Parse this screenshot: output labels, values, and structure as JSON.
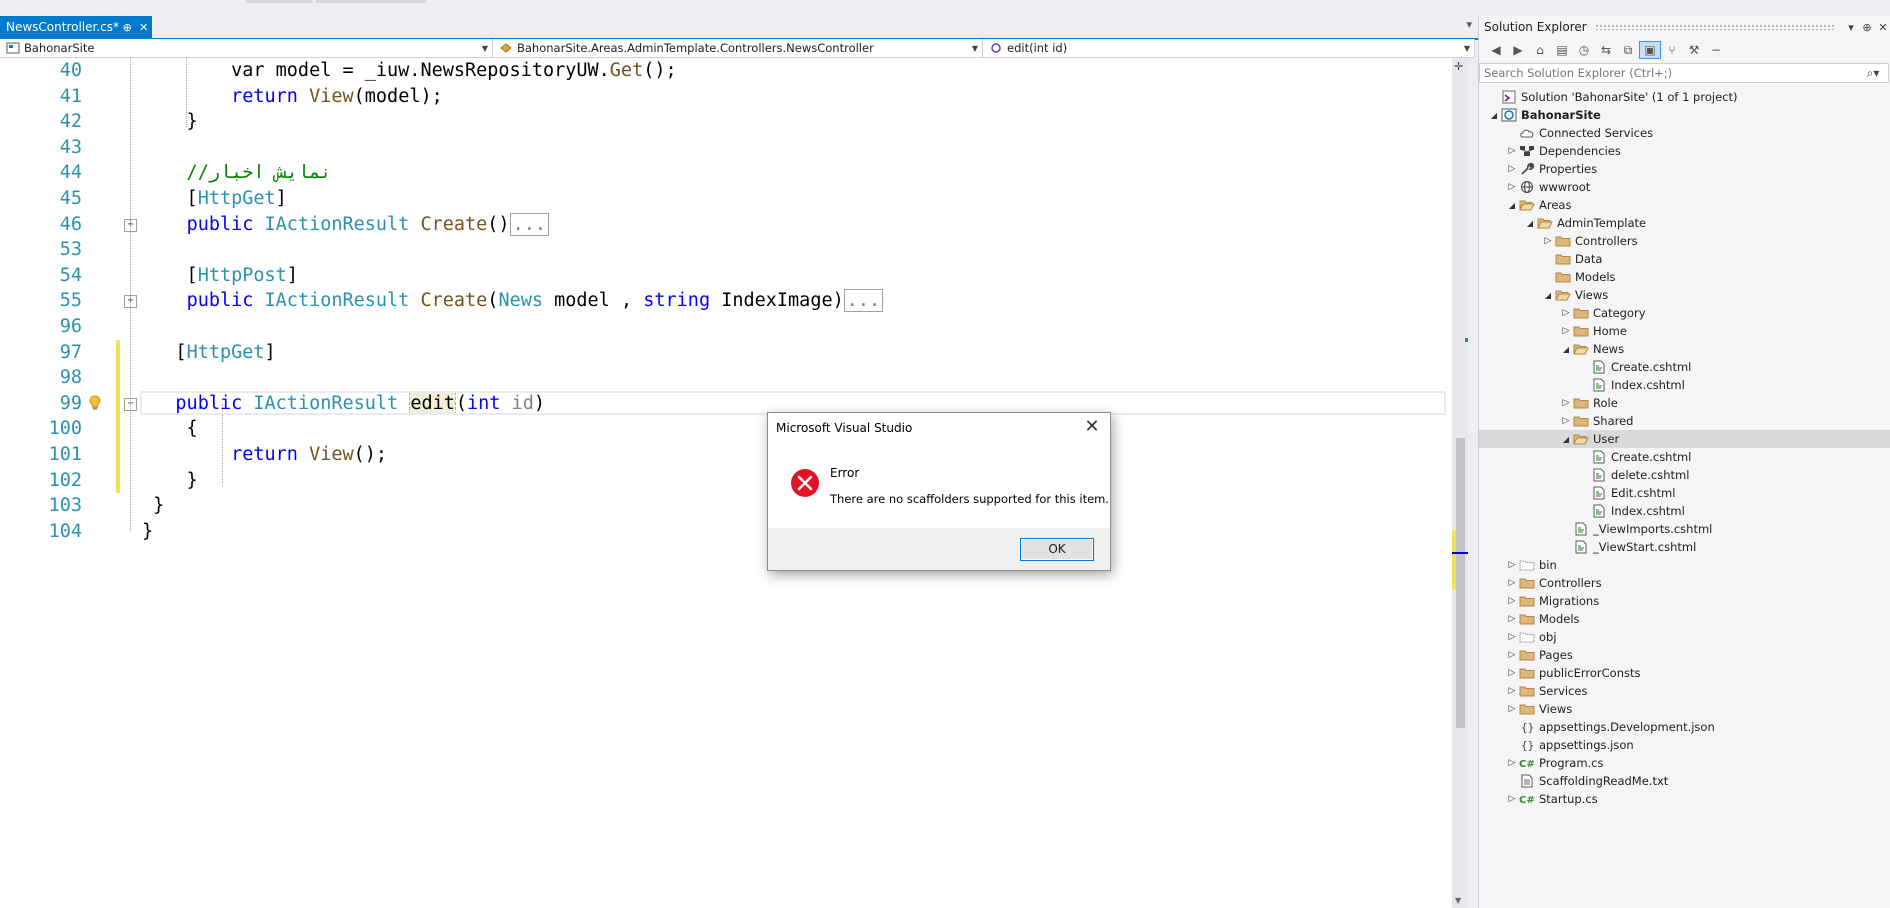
{
  "editor_tab": {
    "name": "NewsController.cs*",
    "pin_icon": "pin-icon",
    "close_icon": "close-icon"
  },
  "navbar": {
    "project": "BahonarSite",
    "class": "BahonarSite.Areas.AdminTemplate.Controllers.NewsController",
    "member": "edit(int id)"
  },
  "code_lines": [
    {
      "num": "40",
      "parts": [
        [
          "",
          "        var model = _iuw.NewsRepositoryUW."
        ],
        [
          "mt",
          "Get"
        ],
        [
          "",
          "();"
        ]
      ]
    },
    {
      "num": "41",
      "parts": [
        [
          "",
          "        "
        ],
        [
          "kw",
          "return"
        ],
        [
          "",
          " "
        ],
        [
          "mt",
          "View"
        ],
        [
          "",
          "(model);"
        ]
      ]
    },
    {
      "num": "42",
      "parts": [
        [
          "",
          "    }"
        ]
      ]
    },
    {
      "num": "43",
      "parts": [
        [
          "",
          ""
        ]
      ]
    },
    {
      "num": "44",
      "parts": [
        [
          "cm",
          "    //نمایش اخبار"
        ]
      ]
    },
    {
      "num": "45",
      "parts": [
        [
          "",
          "    ["
        ],
        [
          "ty",
          "HttpGet"
        ],
        [
          "",
          "]"
        ]
      ]
    },
    {
      "num": "46",
      "parts": [
        [
          "",
          "    "
        ],
        [
          "kw",
          "public"
        ],
        [
          "",
          " "
        ],
        [
          "ty",
          "IActionResult"
        ],
        [
          "",
          " "
        ],
        [
          "mt",
          "Create"
        ],
        [
          "",
          "()"
        ],
        [
          "collapsed",
          "..."
        ]
      ]
    },
    {
      "num": "53",
      "parts": [
        [
          "",
          ""
        ]
      ]
    },
    {
      "num": "54",
      "parts": [
        [
          "",
          "    ["
        ],
        [
          "ty",
          "HttpPost"
        ],
        [
          "",
          "]"
        ]
      ]
    },
    {
      "num": "55",
      "parts": [
        [
          "",
          "    "
        ],
        [
          "kw",
          "public"
        ],
        [
          "",
          " "
        ],
        [
          "ty",
          "IActionResult"
        ],
        [
          "",
          " "
        ],
        [
          "mt",
          "Create"
        ],
        [
          "",
          "("
        ],
        [
          "ty",
          "News"
        ],
        [
          "",
          " model , "
        ],
        [
          "kw",
          "string"
        ],
        [
          "",
          " IndexImage)"
        ],
        [
          "collapsed",
          "..."
        ]
      ]
    },
    {
      "num": "96",
      "parts": [
        [
          "",
          ""
        ]
      ]
    },
    {
      "num": "97",
      "parts": [
        [
          "",
          "   ["
        ],
        [
          "ty",
          "HttpGet"
        ],
        [
          "",
          "]"
        ]
      ]
    },
    {
      "num": "98",
      "parts": [
        [
          "",
          ""
        ]
      ]
    },
    {
      "num": "99",
      "parts": [
        [
          "",
          "   "
        ],
        [
          "kw",
          "public"
        ],
        [
          "",
          " "
        ],
        [
          "ty",
          "IActionResult"
        ],
        [
          "",
          " "
        ],
        [
          "editbox",
          "edit"
        ],
        [
          "",
          "("
        ],
        [
          "kw",
          "int"
        ],
        [
          "",
          " "
        ],
        [
          "pm",
          "id"
        ],
        [
          "",
          ")"
        ]
      ]
    },
    {
      "num": "100",
      "parts": [
        [
          "",
          "    {"
        ]
      ]
    },
    {
      "num": "101",
      "parts": [
        [
          "",
          "        "
        ],
        [
          "kw",
          "return"
        ],
        [
          "",
          " "
        ],
        [
          "mt",
          "View"
        ],
        [
          "",
          "();"
        ]
      ]
    },
    {
      "num": "102",
      "parts": [
        [
          "",
          "    }"
        ]
      ]
    },
    {
      "num": "103",
      "parts": [
        [
          "",
          " }"
        ]
      ]
    },
    {
      "num": "104",
      "parts": [
        [
          "",
          "}"
        ]
      ]
    }
  ],
  "dialog": {
    "title": "Microsoft Visual Studio",
    "heading": "Error",
    "message": "There are no scaffolders supported for this item.",
    "ok_label": "OK"
  },
  "solution_explorer": {
    "title": "Solution Explorer",
    "search_placeholder": "Search Solution Explorer (Ctrl+;)",
    "items": [
      {
        "label": "Solution 'BahonarSite' (1 of 1 project)",
        "level": 0,
        "expander": "",
        "icon": "solution"
      },
      {
        "label": "BahonarSite",
        "level": 0,
        "expander": "open",
        "icon": "project",
        "bold": true
      },
      {
        "label": "Connected Services",
        "level": 1,
        "expander": "",
        "icon": "cloud"
      },
      {
        "label": "Dependencies",
        "level": 1,
        "expander": "closed",
        "icon": "deps"
      },
      {
        "label": "Properties",
        "level": 1,
        "expander": "closed",
        "icon": "wrench"
      },
      {
        "label": "wwwroot",
        "level": 1,
        "expander": "closed",
        "icon": "globe"
      },
      {
        "label": "Areas",
        "level": 1,
        "expander": "open",
        "icon": "folder-open"
      },
      {
        "label": "AdminTemplate",
        "level": 2,
        "expander": "open",
        "icon": "folder-open"
      },
      {
        "label": "Controllers",
        "level": 3,
        "expander": "closed",
        "icon": "folder"
      },
      {
        "label": "Data",
        "level": 3,
        "expander": "",
        "icon": "folder"
      },
      {
        "label": "Models",
        "level": 3,
        "expander": "",
        "icon": "folder"
      },
      {
        "label": "Views",
        "level": 3,
        "expander": "open",
        "icon": "folder-open"
      },
      {
        "label": "Category",
        "level": 4,
        "expander": "closed",
        "icon": "folder"
      },
      {
        "label": "Home",
        "level": 4,
        "expander": "closed",
        "icon": "folder"
      },
      {
        "label": "News",
        "level": 4,
        "expander": "open",
        "icon": "folder-open"
      },
      {
        "label": "Create.cshtml",
        "level": 5,
        "expander": "",
        "icon": "file"
      },
      {
        "label": "Index.cshtml",
        "level": 5,
        "expander": "",
        "icon": "file"
      },
      {
        "label": "Role",
        "level": 4,
        "expander": "closed",
        "icon": "folder"
      },
      {
        "label": "Shared",
        "level": 4,
        "expander": "closed",
        "icon": "folder"
      },
      {
        "label": "User",
        "level": 4,
        "expander": "open",
        "icon": "folder-open",
        "highlight": true
      },
      {
        "label": "Create.cshtml",
        "level": 5,
        "expander": "",
        "icon": "file"
      },
      {
        "label": "delete.cshtml",
        "level": 5,
        "expander": "",
        "icon": "file"
      },
      {
        "label": "Edit.cshtml",
        "level": 5,
        "expander": "",
        "icon": "file"
      },
      {
        "label": "Index.cshtml",
        "level": 5,
        "expander": "",
        "icon": "file"
      },
      {
        "label": "_ViewImports.cshtml",
        "level": 4,
        "expander": "",
        "icon": "file"
      },
      {
        "label": "_ViewStart.cshtml",
        "level": 4,
        "expander": "",
        "icon": "file"
      },
      {
        "label": "bin",
        "level": 1,
        "expander": "closed",
        "icon": "folder-ghost"
      },
      {
        "label": "Controllers",
        "level": 1,
        "expander": "closed",
        "icon": "folder"
      },
      {
        "label": "Migrations",
        "level": 1,
        "expander": "closed",
        "icon": "folder"
      },
      {
        "label": "Models",
        "level": 1,
        "expander": "closed",
        "icon": "folder"
      },
      {
        "label": "obj",
        "level": 1,
        "expander": "closed",
        "icon": "folder-ghost"
      },
      {
        "label": "Pages",
        "level": 1,
        "expander": "closed",
        "icon": "folder"
      },
      {
        "label": "publicErrorConsts",
        "level": 1,
        "expander": "closed",
        "icon": "folder"
      },
      {
        "label": "Services",
        "level": 1,
        "expander": "closed",
        "icon": "folder"
      },
      {
        "label": "Views",
        "level": 1,
        "expander": "closed",
        "icon": "folder"
      },
      {
        "label": "appsettings.Development.json",
        "level": 1,
        "expander": "",
        "icon": "json"
      },
      {
        "label": "appsettings.json",
        "level": 1,
        "expander": "",
        "icon": "json"
      },
      {
        "label": "Program.cs",
        "level": 1,
        "expander": "closed",
        "icon": "cs"
      },
      {
        "label": "ScaffoldingReadMe.txt",
        "level": 1,
        "expander": "",
        "icon": "txt"
      },
      {
        "label": "Startup.cs",
        "level": 1,
        "expander": "closed",
        "icon": "cs"
      }
    ]
  },
  "colors": {
    "accent": "#007acc",
    "keyword": "#0000ff",
    "type": "#2b91af",
    "comment": "#008000",
    "method": "#74531f",
    "error_icon": "#e81123",
    "folder": "#dcb67a"
  }
}
